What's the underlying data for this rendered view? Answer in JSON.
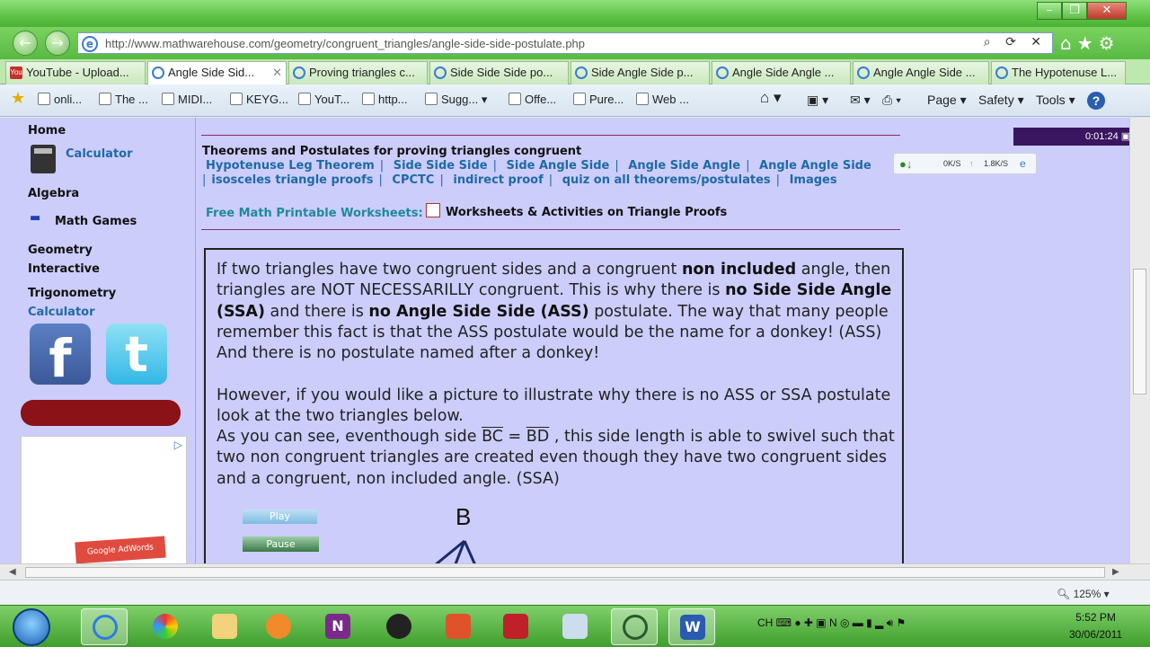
{
  "browser": {
    "url": "http://www.mathwarehouse.com/geometry/congruent_triangles/angle-side-side-postulate.php",
    "tabs": [
      {
        "label": "YouTube - Upload..."
      },
      {
        "label": "Angle Side Sid..."
      },
      {
        "label": "Proving triangles c..."
      },
      {
        "label": "Side Side Side po..."
      },
      {
        "label": "Side Angle Side p..."
      },
      {
        "label": "Angle Side Angle ..."
      },
      {
        "label": "Angle Angle Side ..."
      },
      {
        "label": "The Hypotenuse L..."
      }
    ],
    "favorites": [
      {
        "label": "onli..."
      },
      {
        "label": "The ..."
      },
      {
        "label": "MIDI..."
      },
      {
        "label": "KEYG..."
      },
      {
        "label": "YouT..."
      },
      {
        "label": "http..."
      },
      {
        "label": "Sugg..."
      },
      {
        "label": "Offe..."
      },
      {
        "label": "Pure..."
      },
      {
        "label": "Web ..."
      }
    ],
    "commands": {
      "page": "Page",
      "safety": "Safety",
      "tools": "Tools",
      "help": "?"
    },
    "zoom": "125%",
    "recorder_time": "0:01:24",
    "speed_down": "0K/S",
    "speed_up": "1.8K/S"
  },
  "sidebar": {
    "home": "Home",
    "calculator": "Calculator",
    "algebra": "Algebra",
    "math_games": "Math Games",
    "geometry": "Geometry",
    "interactive": "Interactive",
    "trigonometry": "Trigonometry",
    "trig_calculator": "Calculator",
    "ad_text": "Google AdWords"
  },
  "main": {
    "theorems_title": "Theorems and Postulates for proving triangles congruent",
    "links_row1": [
      "Hypotenuse Leg Theorem",
      "Side Side Side",
      "Side Angle Side",
      "Angle Side Angle",
      "Angle Angle Side"
    ],
    "links_row2": [
      "isosceles triangle proofs",
      "CPCTC",
      "indirect proof",
      "quiz on all theorems/postulates",
      "Images"
    ],
    "free_label": "Free Math Printable Worksheets:",
    "worksheets_link": "Worksheets & Activities on Triangle Proofs",
    "para1": {
      "t1": "If two triangles have two congruent sides and a congruent ",
      "b1": "non included",
      "t2": " angle, then triangles are NOT NECESSARILLY congruent. This is why there is ",
      "b2": "no Side Side Angle (SSA)",
      "t3": " and there is ",
      "b3": "no Angle Side Side (ASS)",
      "t4": " postulate. The way that many people remember this fact is that the ASS postulate would be the name for a donkey! (ASS) And there is no postulate named after a donkey!"
    },
    "para2": "However, if you would like a picture to illustrate why there is no ASS or SSA postulate look at the two triangles below.",
    "para3": {
      "t1": "As you can see, eventhough side ",
      "bc": "BC",
      "eq": " = ",
      "bd": "BD",
      "t2": " , this side length is able to swivel such that two non congruent triangles are created even though they have two congruent sides and a congruent, non included angle. (SSA)"
    },
    "play": "Play",
    "pause": "Pause",
    "point_b": "B"
  },
  "taskbar": {
    "lang": "CH",
    "time": "5:52 PM",
    "date": "30/06/2011"
  }
}
